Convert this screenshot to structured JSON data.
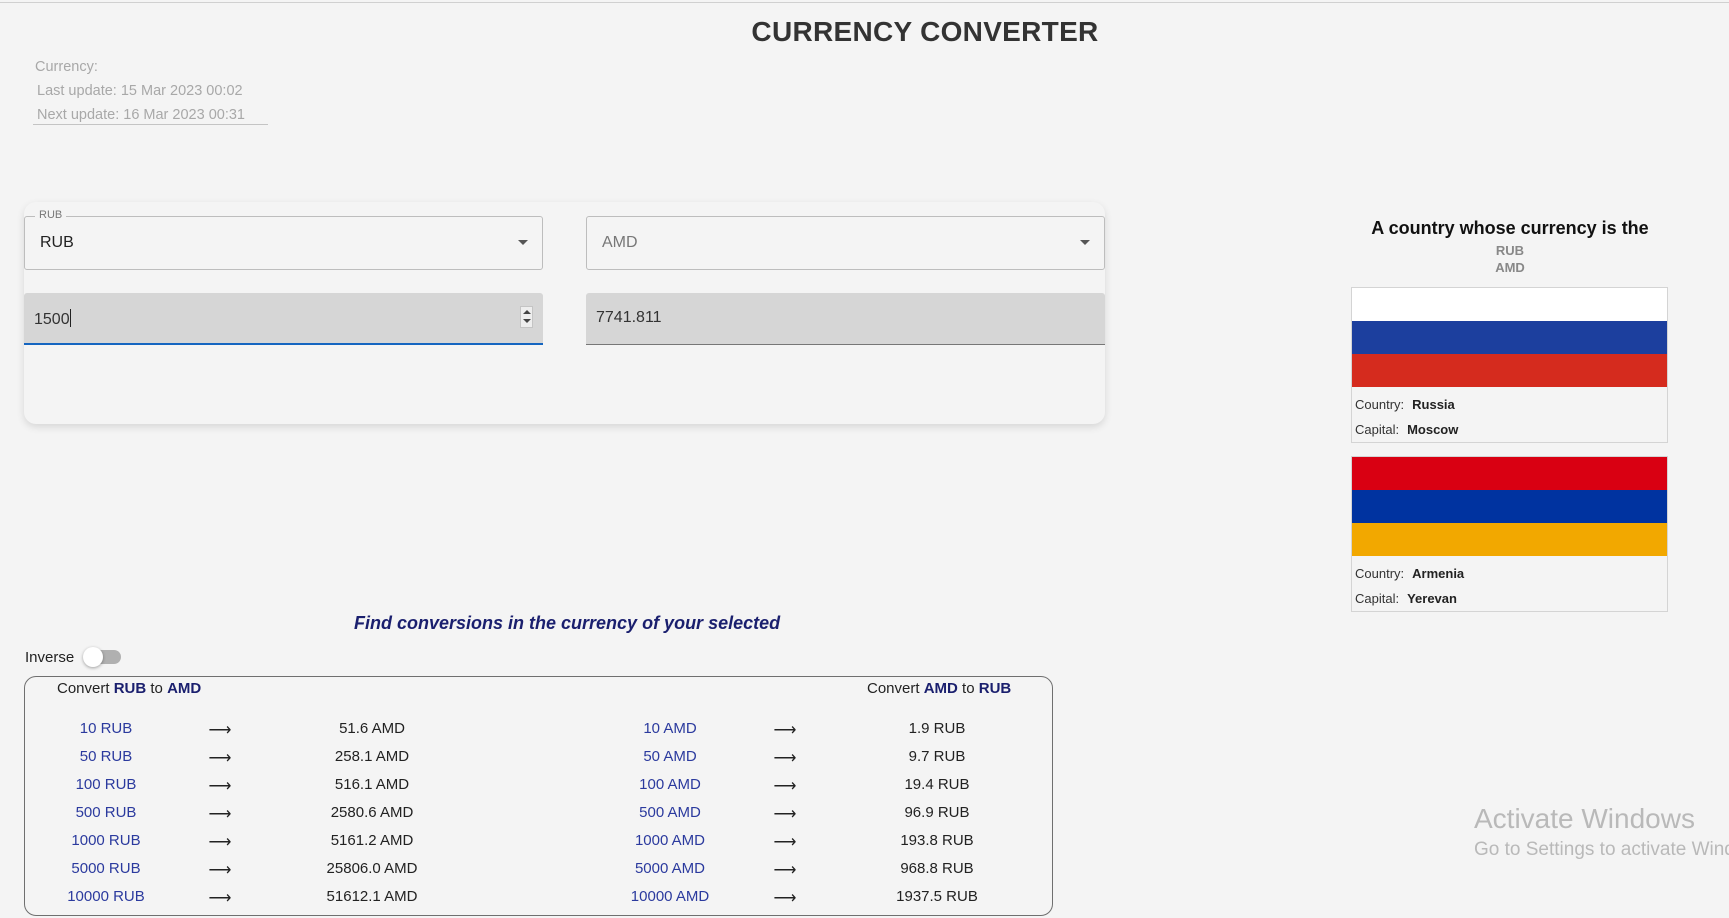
{
  "header": {
    "title": "CURRENCY CONVERTER"
  },
  "info": {
    "currency_label": "Currency:",
    "last_update": "Last update: 15 Mar 2023 00:02",
    "next_update": "Next update: 16 Mar 2023 00:31"
  },
  "converter": {
    "from_select": {
      "legend": "RUB",
      "value": "RUB"
    },
    "to_select": {
      "value": "AMD"
    },
    "amount_input": "1500",
    "result_output": "7741.811"
  },
  "side": {
    "heading": "A country whose currency is the",
    "codes": [
      "RUB",
      "AMD"
    ],
    "cards": [
      {
        "country_label": "Country:",
        "country": "Russia",
        "capital_label": "Capital:",
        "capital": "Moscow",
        "flag_colors": [
          "#ffffff",
          "#1c3f9e",
          "#d52b1e"
        ]
      },
      {
        "country_label": "Country:",
        "country": "Armenia",
        "capital_label": "Capital:",
        "capital": "Yerevan",
        "flag_colors": [
          "#d90012",
          "#0033a0",
          "#f2a800"
        ]
      }
    ]
  },
  "conversions": {
    "find_title": "Find conversions in the currency of your selected",
    "inverse_label": "Inverse",
    "inverse_on": false,
    "left_head": {
      "prefix": "Convert",
      "from": "RUB",
      "mid": "to",
      "to": "AMD"
    },
    "right_head": {
      "prefix": "Convert",
      "from": "AMD",
      "mid": "to",
      "to": "RUB"
    },
    "arrow": "⟶",
    "left_rows": [
      {
        "from": "10 RUB",
        "to": "51.6 AMD"
      },
      {
        "from": "50 RUB",
        "to": "258.1 AMD"
      },
      {
        "from": "100 RUB",
        "to": "516.1 AMD"
      },
      {
        "from": "500 RUB",
        "to": "2580.6 AMD"
      },
      {
        "from": "1000 RUB",
        "to": "5161.2 AMD"
      },
      {
        "from": "5000 RUB",
        "to": "25806.0 AMD"
      },
      {
        "from": "10000 RUB",
        "to": "51612.1 AMD"
      }
    ],
    "right_rows": [
      {
        "from": "10 AMD",
        "to": "1.9 RUB"
      },
      {
        "from": "50 AMD",
        "to": "9.7 RUB"
      },
      {
        "from": "100 AMD",
        "to": "19.4 RUB"
      },
      {
        "from": "500 AMD",
        "to": "96.9 RUB"
      },
      {
        "from": "1000 AMD",
        "to": "193.8 RUB"
      },
      {
        "from": "5000 AMD",
        "to": "968.8 RUB"
      },
      {
        "from": "10000 AMD",
        "to": "1937.5 RUB"
      }
    ]
  },
  "watermark": {
    "line1": "Activate Windows",
    "line2": "Go to Settings to activate Windows."
  }
}
